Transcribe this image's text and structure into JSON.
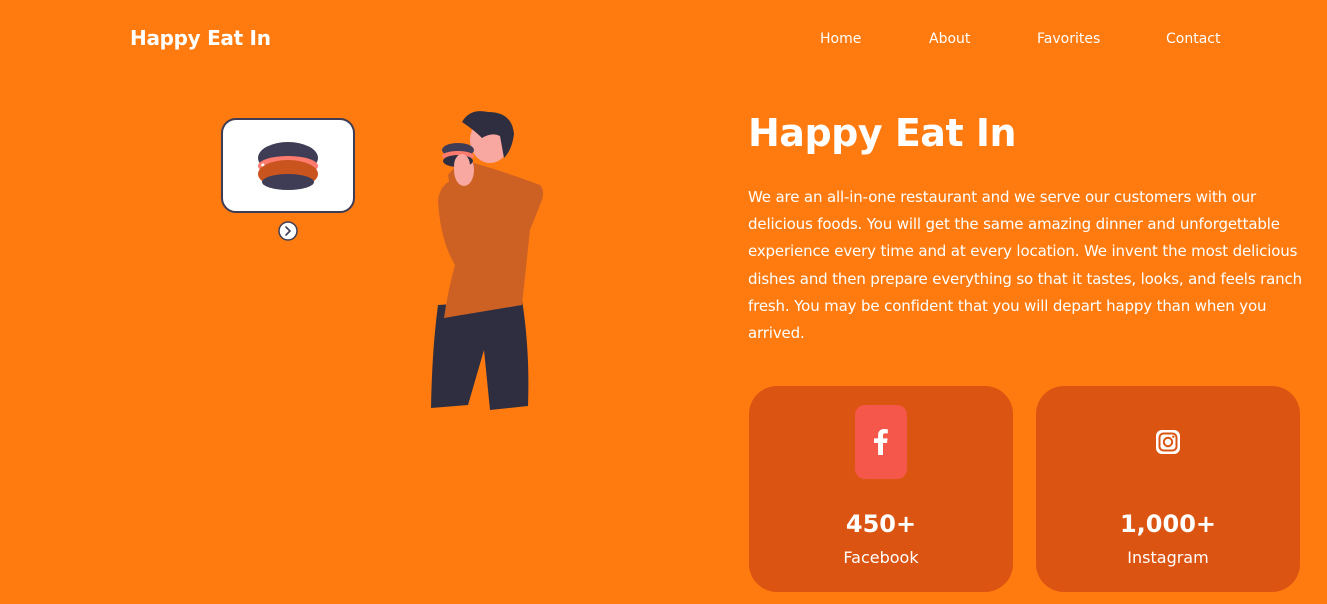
{
  "nav": {
    "brand": "Happy Eat In",
    "links": [
      "Home",
      "About",
      "Favorites",
      "Contact"
    ]
  },
  "hero": {
    "title": "Happy Eat In",
    "description": "We are an all-in-one restaurant and we serve our customers with our delicious foods. You will get the same amazing dinner and unforgettable experience every time and at every location. We invent the most delicious dishes and then prepare everything so that it tastes, looks, and feels ranch fresh. You may be confident that you will depart happy than when you arrived."
  },
  "stats": [
    {
      "count": "450+",
      "label": "Facebook",
      "icon": "facebook-icon"
    },
    {
      "count": "1,000+",
      "label": "Instagram",
      "icon": "instagram-icon"
    }
  ],
  "colors": {
    "background": "#ff7b0f",
    "card": "#dc5411",
    "facebook_badge": "#f5574a",
    "text": "#ffffff"
  }
}
